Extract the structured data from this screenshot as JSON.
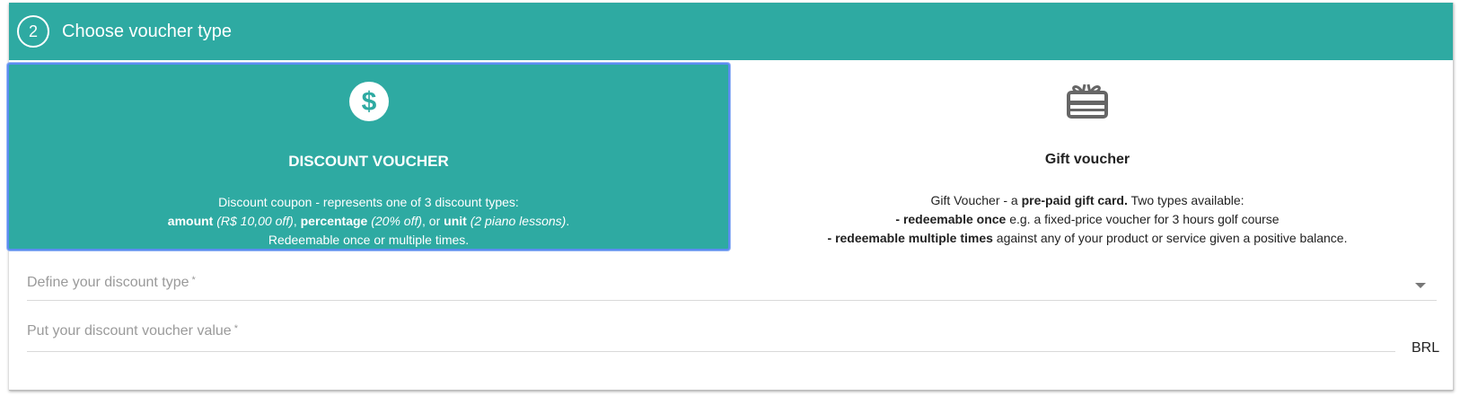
{
  "section": {
    "step_number": "2",
    "title": "Choose voucher type"
  },
  "cards": {
    "discount": {
      "icon": "dollar-circle-icon",
      "title": "DISCOUNT VOUCHER",
      "desc_line1": "Discount coupon - represents one of 3 discount types:",
      "desc_line2": {
        "amount": "amount",
        "amount_example": "(R$ 10,00 off)",
        "sep1": ", ",
        "percentage": "percentage",
        "percentage_example": "(20% off)",
        "sep2": ", or ",
        "unit": "unit",
        "unit_example": "(2 piano lessons)",
        "end": "."
      },
      "desc_line3": "Redeemable once or multiple times.",
      "selected": true
    },
    "gift": {
      "icon": "gift-card-icon",
      "title": "Gift voucher",
      "desc_line1_pre": "Gift Voucher - a ",
      "desc_line1_bold": "pre-paid gift card.",
      "desc_line1_post": " Two types available:",
      "desc_line2_bold": "- redeemable once",
      "desc_line2_post": " e.g. a fixed-price voucher for 3 hours golf course",
      "desc_line3_bold": "- redeemable multiple times",
      "desc_line3_post": " against any of your product or service given a positive balance."
    }
  },
  "form": {
    "discount_type_label": "Define your discount type",
    "discount_value_label": "Put your discount voucher value",
    "required_mark": "*",
    "currency": "BRL"
  },
  "colors": {
    "accent": "#2eaaa2",
    "selected_border": "#5b8cf0"
  }
}
